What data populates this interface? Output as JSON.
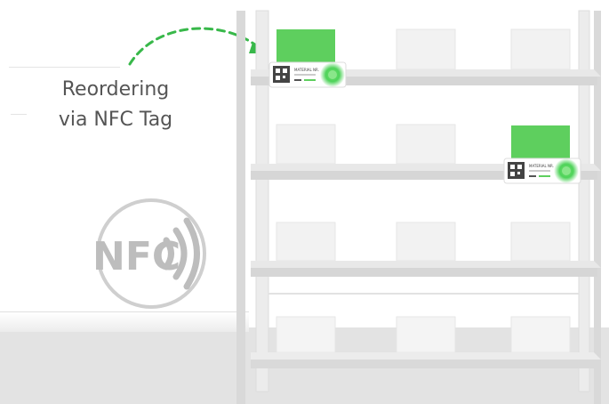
{
  "caption": {
    "line1": "Reordering",
    "line2": "via NFC Tag"
  },
  "nfc_logo": {
    "text": "NFC",
    "color": "#bdbdbd"
  },
  "colors": {
    "accent_green": "#5ecf5e",
    "dash_green": "#38b84a",
    "glow_green": "#4fd35a",
    "shelf_gray": "#dcdcdc",
    "box_gray": "#f2f2f2",
    "floor_gray": "#e3e3e3"
  },
  "tags": {
    "text": "MATERIAL NR."
  },
  "icons": {
    "reorder_arrow": "dashed-curved-arrow-icon",
    "nfc": "nfc-logo-icon",
    "tag_status": "green-glow-status-icon",
    "qr": "qr-code-icon"
  }
}
